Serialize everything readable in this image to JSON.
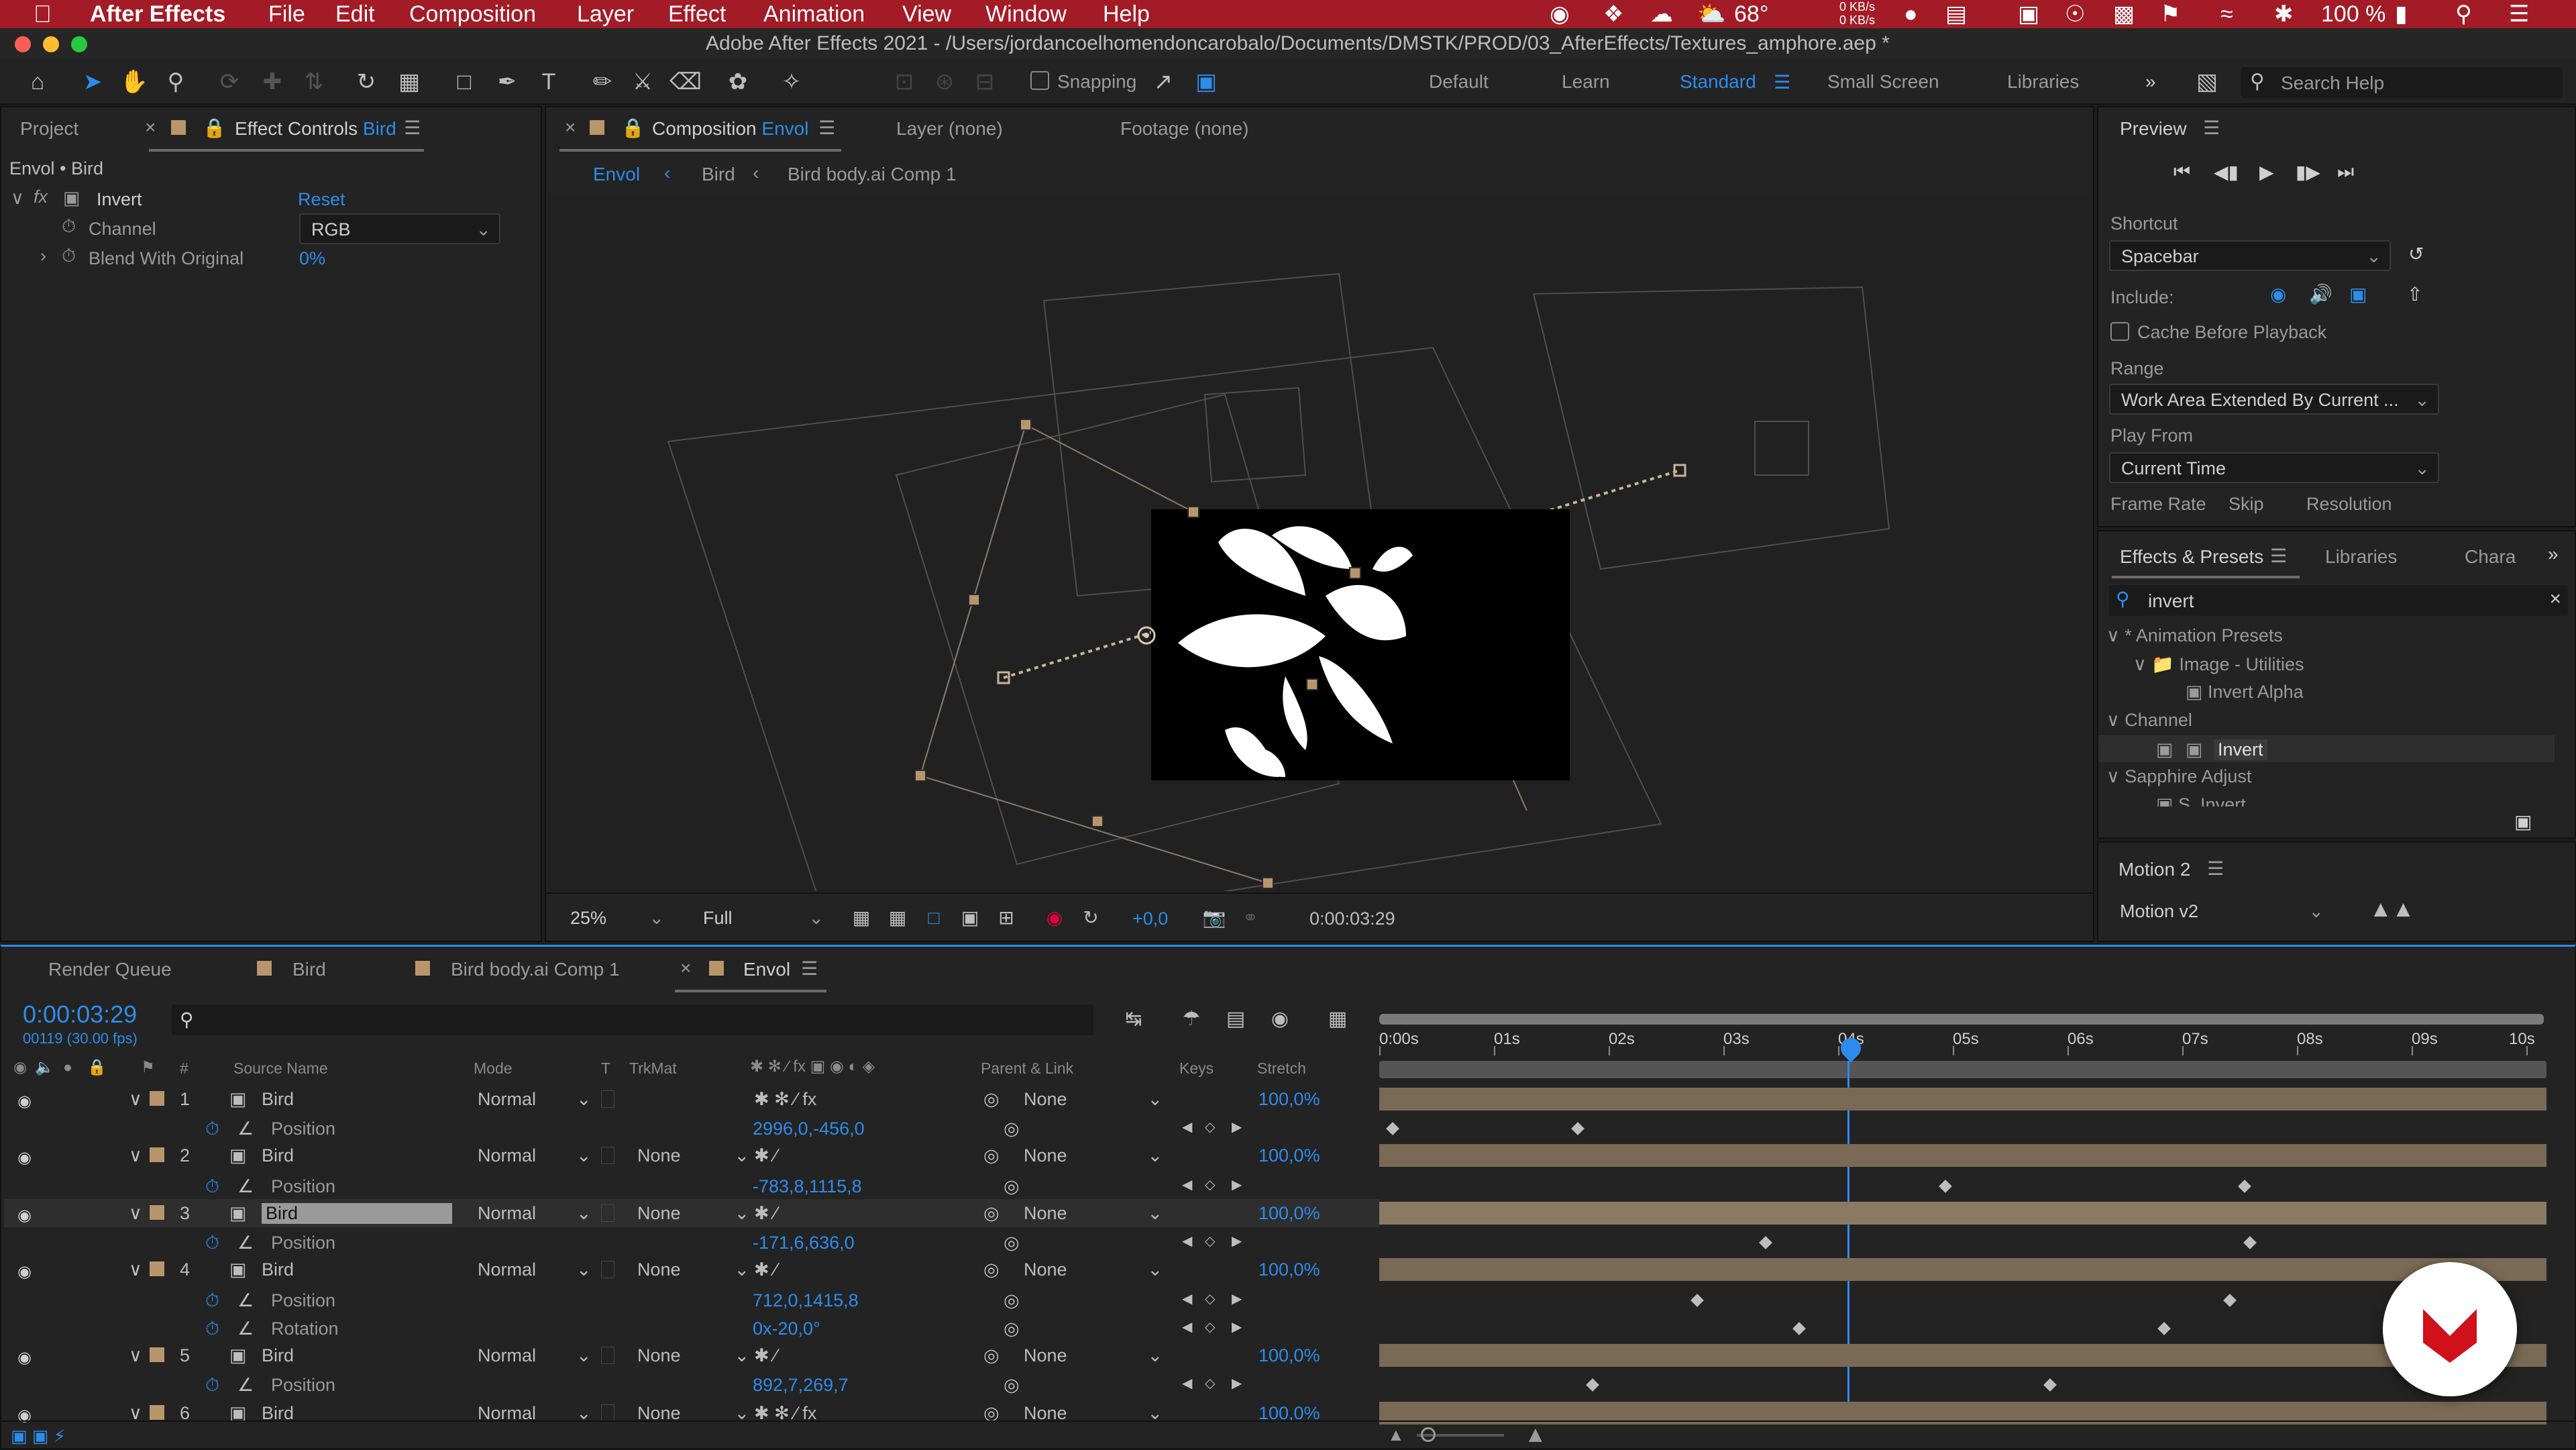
{
  "menubar": {
    "app_name": "After Effects",
    "items": [
      "File",
      "Edit",
      "Composition",
      "Layer",
      "Effect",
      "Animation",
      "View",
      "Window",
      "Help"
    ],
    "weather": "68°",
    "net_up": "0 KB/s",
    "net_down": "0 KB/s",
    "battery": "100 %"
  },
  "window": {
    "title": "Adobe After Effects 2021 - /Users/jordancoelhomendoncarobalo/Documents/DMSTK/PROD/03_AfterEffects/Textures_amphore.aep *"
  },
  "toolbar": {
    "snapping_label": "Snapping",
    "workspaces": [
      "Default",
      "Learn",
      "Standard",
      "Small Screen",
      "Libraries"
    ],
    "active_workspace": "Standard",
    "search_placeholder": "Search Help"
  },
  "effect_controls": {
    "tab_project": "Project",
    "tab_label": "Effect Controls",
    "tab_layer": "Bird",
    "subtitle": "Envol • Bird",
    "effect_name": "Invert",
    "reset_label": "Reset",
    "channel_label": "Channel",
    "channel_value": "RGB",
    "blend_label": "Blend With Original",
    "blend_value": "0%"
  },
  "composition": {
    "tab_label": "Composition",
    "tab_comp": "Envol",
    "layer_tab": "Layer (none)",
    "footage_tab": "Footage (none)",
    "breadcrumbs": [
      "Envol",
      "Bird",
      "Bird body.ai Comp 1"
    ],
    "zoom": "25%",
    "resolution": "Full",
    "exposure": "+0,0",
    "timecode": "0:00:03:29"
  },
  "preview": {
    "title": "Preview",
    "shortcut_label": "Shortcut",
    "shortcut_value": "Spacebar",
    "include_label": "Include:",
    "cache_label": "Cache Before Playback",
    "range_label": "Range",
    "range_value": "Work Area Extended By Current ...",
    "play_from_label": "Play From",
    "play_from_value": "Current Time",
    "frame_rate_label": "Frame Rate",
    "skip_label": "Skip",
    "resolution_label": "Resolution"
  },
  "effects_presets": {
    "tab_label": "Effects & Presets",
    "tab_libraries": "Libraries",
    "tab_chara": "Chara",
    "search_value": "invert",
    "tree": [
      {
        "label": "* Animation Presets",
        "level": 0
      },
      {
        "label": "Image - Utilities",
        "level": 1
      },
      {
        "label": "Invert Alpha",
        "level": 2
      },
      {
        "label": "Channel",
        "level": 0
      },
      {
        "label": "Invert",
        "level": 1
      },
      {
        "label": "Sapphire Adjust",
        "level": 0
      },
      {
        "label": "S_Invert",
        "level": 1
      }
    ]
  },
  "motion2": {
    "title": "Motion 2",
    "dropdown_value": "Motion v2"
  },
  "timeline": {
    "tabs": [
      "Render Queue",
      "Bird",
      "Bird body.ai Comp 1",
      "Envol"
    ],
    "current_time": "0:00:03:29",
    "frame_info": "00119 (30.00 fps)",
    "headers": {
      "hash": "#",
      "source_name": "Source Name",
      "mode": "Mode",
      "t": "T",
      "trkmat": "TrkMat",
      "parent": "Parent & Link",
      "keys": "Keys",
      "stretch": "Stretch"
    },
    "ruler": [
      "0:00s",
      "01s",
      "02s",
      "03s",
      "04s",
      "05s",
      "06s",
      "07s",
      "08s",
      "09s",
      "10s"
    ],
    "rows": [
      {
        "type": "layer",
        "num": "1",
        "name": "Bird",
        "mode": "Normal",
        "trkmat": "",
        "parent": "None",
        "stretch": "100,0%"
      },
      {
        "type": "prop",
        "name": "Position",
        "value": "2996,0,-456,0"
      },
      {
        "type": "layer",
        "num": "2",
        "name": "Bird",
        "mode": "Normal",
        "trkmat": "None",
        "parent": "None",
        "stretch": "100,0%"
      },
      {
        "type": "prop",
        "name": "Position",
        "value": "-783,8,1115,8"
      },
      {
        "type": "layer",
        "num": "3",
        "name": "Bird",
        "mode": "Normal",
        "trkmat": "None",
        "parent": "None",
        "stretch": "100,0%"
      },
      {
        "type": "prop",
        "name": "Position",
        "value": "-171,6,636,0"
      },
      {
        "type": "layer",
        "num": "4",
        "name": "Bird",
        "mode": "Normal",
        "trkmat": "None",
        "parent": "None",
        "stretch": "100,0%"
      },
      {
        "type": "prop",
        "name": "Position",
        "value": "712,0,1415,8"
      },
      {
        "type": "prop",
        "name": "Rotation",
        "value": "0x-20,0°"
      },
      {
        "type": "layer",
        "num": "5",
        "name": "Bird",
        "mode": "Normal",
        "trkmat": "None",
        "parent": "None",
        "stretch": "100,0%"
      },
      {
        "type": "prop",
        "name": "Position",
        "value": "892,7,269,7"
      },
      {
        "type": "layer",
        "num": "6",
        "name": "Bird",
        "mode": "Normal",
        "trkmat": "None",
        "parent": "None",
        "stretch": "100,0%"
      }
    ]
  },
  "colors": {
    "accent": "#2d8ceb",
    "menubar": "#a31b26",
    "layer_bar": "#7a6a55",
    "label_swatch": "#b8956a"
  }
}
